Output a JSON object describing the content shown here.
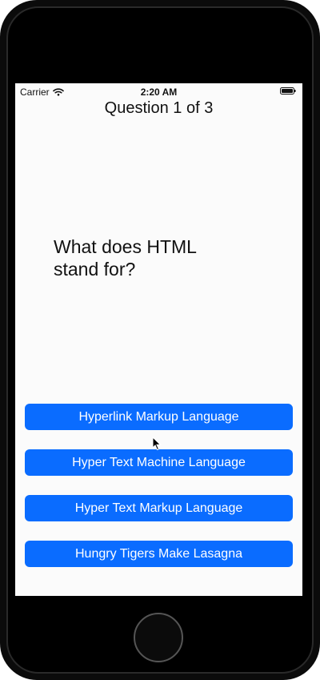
{
  "status_bar": {
    "carrier": "Carrier",
    "time": "2:20 AM",
    "wifi_icon": "wifi-icon",
    "battery_icon": "battery-icon"
  },
  "quiz": {
    "counter": "Question 1 of 3",
    "question": "What does HTML stand for?",
    "answers": [
      "Hyperlink Markup Language",
      "Hyper Text Machine Language",
      "Hyper Text Markup Language",
      "Hungry Tigers Make Lasagna"
    ]
  },
  "colors": {
    "accent": "#0a6cff",
    "screen_background": "#fbfbfb",
    "device_frame": "#0b0b0b"
  },
  "icons": {
    "cursor": "pointer-cursor-icon",
    "home": "home-button"
  }
}
